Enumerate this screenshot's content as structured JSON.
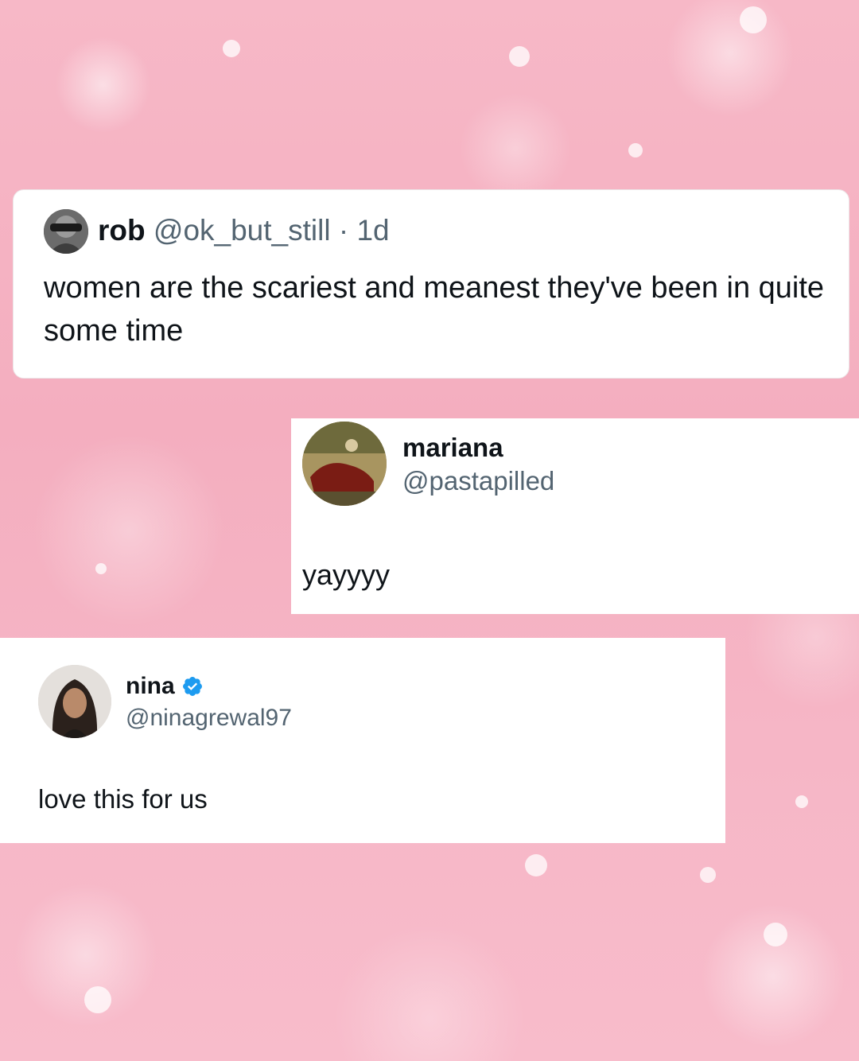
{
  "tweets": {
    "rob": {
      "name": "rob",
      "handle": "@ok_but_still",
      "separator": " · ",
      "time": "1d",
      "text": "women are the scariest and meanest they've been in quite some time"
    },
    "mariana": {
      "name": "mariana",
      "handle": "@pastapilled",
      "text": "yayyyy"
    },
    "nina": {
      "name": "nina",
      "handle": "@ninagrewal97",
      "text": "love this for us",
      "verified": true
    }
  },
  "colors": {
    "background": "#f6b6c6",
    "card": "#ffffff",
    "text": "#0f1419",
    "secondary": "#536471",
    "verified": "#1d9bf0"
  },
  "icons": {
    "verified": "verified-badge-icon"
  }
}
